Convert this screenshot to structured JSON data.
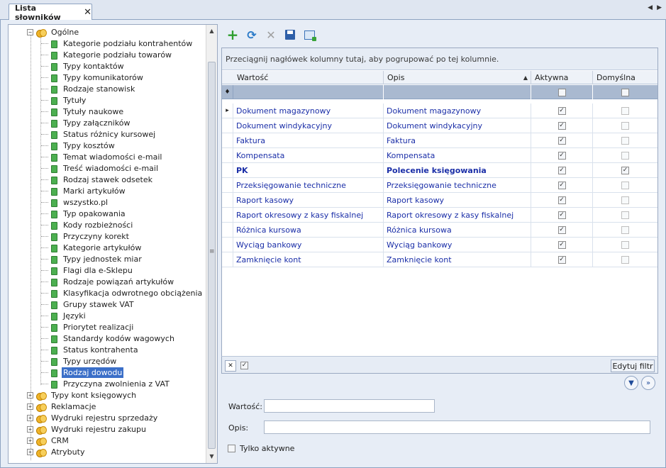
{
  "tab": {
    "title": "Lista słowników",
    "close": "✕"
  },
  "tree": {
    "root": "Ogólne",
    "children": [
      "Kategorie podziału kontrahentów",
      "Kategorie podziału towarów",
      "Typy kontaktów",
      "Typy komunikatorów",
      "Rodzaje stanowisk",
      "Tytuły",
      "Tytuły naukowe",
      "Typy załączników",
      "Status różnicy kursowej",
      "Typy kosztów",
      "Temat wiadomości e-mail",
      "Treść wiadomości e-mail",
      "Rodzaj stawek odsetek",
      "Marki artykułów",
      "wszystko.pl",
      "Typ opakowania",
      "Kody rozbieżności",
      "Przyczyny korekt",
      "Kategorie artykułów",
      "Typy jednostek miar",
      "Flagi dla e-Sklepu",
      "Rodzaje powiązań artykułów",
      "Klasyfikacja odwrotnego obciążenia",
      "Grupy stawek VAT",
      "Języki",
      "Priorytet realizacji",
      "Standardy kodów wagowych",
      "Status kontrahenta",
      "Typy urzędów",
      "Rodzaj dowodu",
      "Przyczyna zwolnienia z VAT"
    ],
    "selected_index": 29,
    "other_groups": [
      "Typy kont księgowych",
      "Reklamacje",
      "Wydruki rejestru sprzedaży",
      "Wydruki rejestru zakupu",
      "CRM",
      "Atrybuty"
    ]
  },
  "grid": {
    "group_hint": "Przeciągnij nagłówek kolumny tutaj, aby pogrupować po tej kolumnie.",
    "columns": [
      "Wartość",
      "Opis",
      "Aktywna",
      "Domyślna"
    ],
    "rows": [
      {
        "value": "Dokument magazynowy",
        "desc": "Dokument magazynowy",
        "active": true,
        "default": false
      },
      {
        "value": "Dokument windykacyjny",
        "desc": "Dokument windykacyjny",
        "active": true,
        "default": false
      },
      {
        "value": "Faktura",
        "desc": "Faktura",
        "active": true,
        "default": false
      },
      {
        "value": "Kompensata",
        "desc": "Kompensata",
        "active": true,
        "default": false
      },
      {
        "value": "PK",
        "desc": "Polecenie księgowania",
        "active": true,
        "default": true
      },
      {
        "value": "Przeksięgowanie techniczne",
        "desc": "Przeksięgowanie techniczne",
        "active": true,
        "default": false
      },
      {
        "value": "Raport kasowy",
        "desc": "Raport kasowy",
        "active": true,
        "default": false
      },
      {
        "value": "Raport okresowy z kasy fiskalnej",
        "desc": "Raport okresowy z kasy fiskalnej",
        "active": true,
        "default": false
      },
      {
        "value": "Różnica kursowa",
        "desc": "Różnica kursowa",
        "active": true,
        "default": false
      },
      {
        "value": "Wyciąg bankowy",
        "desc": "Wyciąg bankowy",
        "active": true,
        "default": false
      },
      {
        "value": "Zamknięcie kont",
        "desc": "Zamknięcie kont",
        "active": true,
        "default": false
      }
    ],
    "edit_filter": "Edytuj filtr"
  },
  "form": {
    "value_label": "Wartość:",
    "desc_label": "Opis:",
    "only_active": "Tylko aktywne"
  }
}
